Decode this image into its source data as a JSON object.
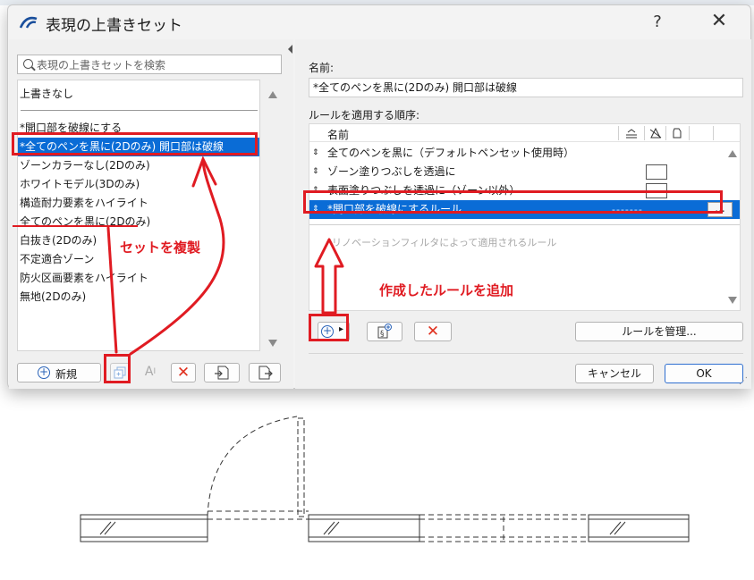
{
  "dialog": {
    "title": "表現の上書きセット",
    "help": "?",
    "close": "✕"
  },
  "left": {
    "search_placeholder": "表現の上書きセットを検索",
    "none_item": "上書きなし",
    "sets": [
      {
        "label": "*開口部を破線にする"
      },
      {
        "label": "*全てのペンを黒に(2Dのみ) 開口部は破線",
        "selected": true
      },
      {
        "label": "ゾーンカラーなし(2Dのみ)"
      },
      {
        "label": "ホワイトモデル(3Dのみ)"
      },
      {
        "label": "構造耐力要素をハイライト"
      },
      {
        "label": "全てのペンを黒に(2Dのみ)"
      },
      {
        "label": "白抜き(2Dのみ)"
      },
      {
        "label": "不定適合ゾーン"
      },
      {
        "label": "防火区画要素をハイライト"
      },
      {
        "label": "無地(2Dのみ)"
      }
    ],
    "toolbar": {
      "new_label": "新規",
      "rename_glyph": "A",
      "delete_glyph": "✕"
    }
  },
  "right": {
    "name_label": "名前:",
    "name_value": "*全てのペンを黒に(2Dのみ) 開口部は破線",
    "order_label": "ルールを適用する順序:",
    "col_name": "名前",
    "rules": [
      {
        "name": "全てのペンを黒に（デフォルトペンセット使用時）",
        "checkbox": false
      },
      {
        "name": "ゾーン塗りつぶしを透過に",
        "checkbox": true
      },
      {
        "name": "表面塗りつぶしを透過に（ゾーン以外）",
        "checkbox": true
      },
      {
        "name": "*開口部を破線にするルール",
        "selected": true,
        "dash": "-------",
        "more": "..."
      }
    ],
    "filter_text": "リノベーションフィルタによって適用されるルール",
    "toolbar": {
      "add_glyph": "+",
      "menu_glyph": "▸",
      "delete_glyph": "✕",
      "manage_label": "ルールを管理..."
    },
    "cancel_label": "キャンセル",
    "ok_label": "OK"
  },
  "annotations": {
    "duplicate_text": "セットを複製",
    "add_rule_text": "作成したルールを追加"
  },
  "colors": {
    "selection": "#0a6cd6",
    "annotation": "#e01b22",
    "delete": "#e0301e",
    "accent": "#2a63b8"
  }
}
